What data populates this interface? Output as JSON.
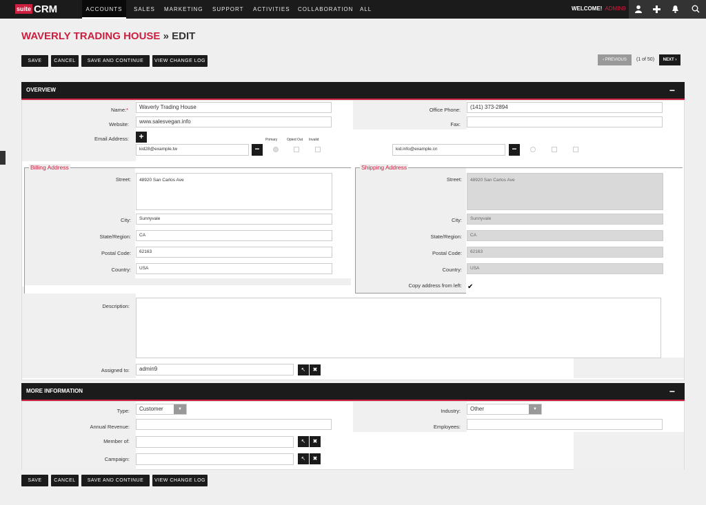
{
  "nav": {
    "brand_suite": "suite",
    "brand_crm": "CRM",
    "items": [
      "ACCOUNTS",
      "SALES",
      "MARKETING",
      "SUPPORT",
      "ACTIVITIES",
      "COLLABORATION",
      "ALL"
    ],
    "welcome": "WELCOME!",
    "user": "ADMIN9",
    "icons": [
      "user-icon",
      "plus-icon",
      "bell-icon",
      "search-icon"
    ]
  },
  "page": {
    "record_name": "WAVERLY TRADING HOUSE",
    "separator": "»",
    "mode": "EDIT"
  },
  "actions": {
    "save": "SAVE",
    "cancel": "CANCEL",
    "save_continue": "SAVE AND CONTINUE",
    "view_log": "VIEW CHANGE LOG"
  },
  "pager": {
    "previous": "PREVIOUS",
    "position": "(1 of 50)",
    "next": "NEXT"
  },
  "overview": {
    "header": "OVERVIEW",
    "collapse": "−",
    "name_label": "Name:",
    "required_mark": "*",
    "name_value": "Waverly Trading House",
    "website_label": "Website:",
    "website_value": "www.salesvegan.info",
    "email_label": "Email Address:",
    "email_primary": "Primary",
    "email_opted_out": "Opted Out",
    "email_invalid": "Invalid",
    "email1": "kid28@example.tw",
    "email2": "kid.info@example.cn",
    "office_phone_label": "Office Phone:",
    "office_phone_value": "(141) 373-2894",
    "fax_label": "Fax:",
    "fax_value": "",
    "billing": {
      "legend": "Billing Address",
      "street_label": "Street:",
      "street": "48920 San Carlos Ave",
      "city_label": "City:",
      "city": "Sunnyvale",
      "state_label": "State/Region:",
      "state": "CA",
      "postal_label": "Postal Code:",
      "postal": "62163",
      "country_label": "Country:",
      "country": "USA"
    },
    "shipping": {
      "legend": "Shipping Address",
      "street_label": "Street:",
      "street": "48920 San Carlos Ave",
      "city_label": "City:",
      "city": "Sunnyvale",
      "state_label": "State/Region:",
      "state": "CA",
      "postal_label": "Postal Code:",
      "postal": "62163",
      "country_label": "Country:",
      "country": "USA",
      "copy_label": "Copy address from left:",
      "copy_checked": true
    },
    "description_label": "Description:",
    "description_value": "",
    "assigned_label": "Assigned to:",
    "assigned_value": "admin9"
  },
  "more_info": {
    "header": "MORE INFORMATION",
    "collapse": "−",
    "type_label": "Type:",
    "type_value": "Customer",
    "industry_label": "Industry:",
    "industry_value": "Other",
    "revenue_label": "Annual Revenue:",
    "revenue_value": "",
    "employees_label": "Employees:",
    "employees_value": "",
    "member_label": "Member of:",
    "member_value": "",
    "campaign_label": "Campaign:",
    "campaign_value": ""
  },
  "colors": {
    "accent": "#cc1f3f",
    "nav_bg": "#1b1b1b",
    "page_bg": "#efefef"
  }
}
